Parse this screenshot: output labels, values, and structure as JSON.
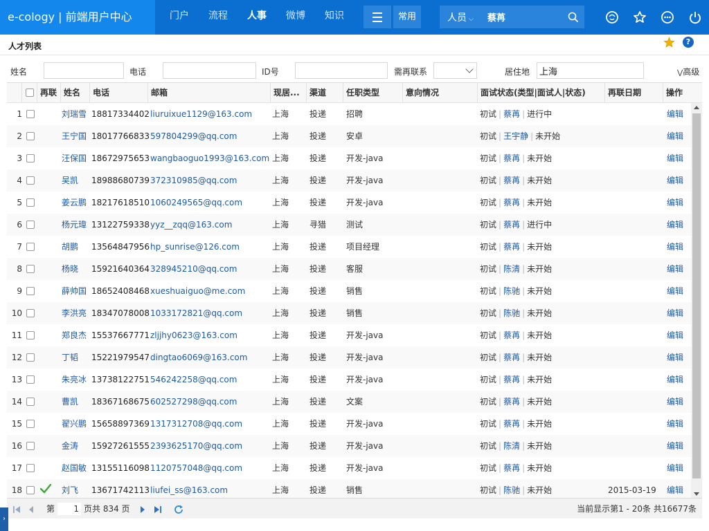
{
  "app": {
    "brand": "e-cology | 前端用户中心"
  },
  "nav": {
    "items": [
      "门户",
      "流程",
      "人事",
      "微博",
      "知识"
    ],
    "active_index": 2
  },
  "toolbar": {
    "common_label": "常用"
  },
  "search": {
    "category": "人员",
    "value": "蔡苒"
  },
  "page": {
    "title": "人才列表"
  },
  "filters": {
    "name_label": "姓名",
    "name_value": "",
    "phone_label": "电话",
    "phone_value": "",
    "id_label": "ID号",
    "id_value": "",
    "recontact_label": "需再联系",
    "recontact_value": "",
    "residence_label": "居住地",
    "residence_value": "上海",
    "advanced_label": "高级"
  },
  "table": {
    "headers": {
      "recontact": "再联",
      "name": "姓名",
      "phone": "电话",
      "email": "邮箱",
      "residence": "现居...",
      "channel": "渠道",
      "position": "任职类型",
      "intention": "意向情况",
      "interview": "面试状态(类型|面试人|状态)",
      "recontact_date": "再联日期",
      "action": "操作"
    },
    "rows": [
      {
        "no": "1",
        "recontact": false,
        "name": "刘瑞雪",
        "phone": "18817334402",
        "email": "liuruixue1129@163.com",
        "residence": "上海",
        "channel": "投递",
        "position": "招聘",
        "intention": "",
        "type": "初试",
        "interviewer": "蔡苒",
        "status": "进行中",
        "date": "",
        "action": "编辑"
      },
      {
        "no": "2",
        "recontact": false,
        "name": "王宁国",
        "phone": "18017766833",
        "email": "597804299@qq.com",
        "residence": "上海",
        "channel": "投递",
        "position": "安卓",
        "intention": "",
        "type": "初试",
        "interviewer": "王宇静",
        "status": "未开始",
        "date": "",
        "action": "编辑"
      },
      {
        "no": "3",
        "recontact": false,
        "name": "汪保国",
        "phone": "18672975653",
        "email": "wangbaoguo1993@163.com",
        "residence": "上海",
        "channel": "投递",
        "position": "开发-java",
        "intention": "",
        "type": "初试",
        "interviewer": "蔡苒",
        "status": "未开始",
        "date": "",
        "action": "编辑"
      },
      {
        "no": "4",
        "recontact": false,
        "name": "吴凯",
        "phone": "18988680739",
        "email": "372310985@qq.com",
        "residence": "上海",
        "channel": "投递",
        "position": "开发-java",
        "intention": "",
        "type": "初试",
        "interviewer": "蔡苒",
        "status": "未开始",
        "date": "",
        "action": "编辑"
      },
      {
        "no": "5",
        "recontact": false,
        "name": "姜云鹏",
        "phone": "18217618510",
        "email": "1060249565@qq.com",
        "residence": "上海",
        "channel": "投递",
        "position": "开发-java",
        "intention": "",
        "type": "初试",
        "interviewer": "蔡苒",
        "status": "未开始",
        "date": "",
        "action": "编辑"
      },
      {
        "no": "6",
        "recontact": false,
        "name": "杨元瑋",
        "phone": "13122759338",
        "email": "yyz__zqq@163.com",
        "residence": "上海",
        "channel": "寻猎",
        "position": "测试",
        "intention": "",
        "type": "初试",
        "interviewer": "蔡苒",
        "status": "进行中",
        "date": "",
        "action": "编辑"
      },
      {
        "no": "7",
        "recontact": false,
        "name": "胡鹏",
        "phone": "13564847956",
        "email": "hp_sunrise@126.com",
        "residence": "上海",
        "channel": "投递",
        "position": "项目经理",
        "intention": "",
        "type": "初试",
        "interviewer": "蔡苒",
        "status": "未开始",
        "date": "",
        "action": "编辑"
      },
      {
        "no": "8",
        "recontact": false,
        "name": "杨晓",
        "phone": "15921640364",
        "email": "328945210@qq.com",
        "residence": "上海",
        "channel": "投递",
        "position": "客服",
        "intention": "",
        "type": "初试",
        "interviewer": "陈清",
        "status": "未开始",
        "date": "",
        "action": "编辑"
      },
      {
        "no": "9",
        "recontact": false,
        "name": "薛帅国",
        "phone": "18652408468",
        "email": "xueshuaiguo@me.com",
        "residence": "上海",
        "channel": "投递",
        "position": "销售",
        "intention": "",
        "type": "初试",
        "interviewer": "陈驰",
        "status": "未开始",
        "date": "",
        "action": "编辑"
      },
      {
        "no": "10",
        "recontact": false,
        "name": "李洪亮",
        "phone": "18347078008",
        "email": "1033172821@qq.com",
        "residence": "上海",
        "channel": "投递",
        "position": "销售",
        "intention": "",
        "type": "初试",
        "interviewer": "陈驰",
        "status": "未开始",
        "date": "",
        "action": "编辑"
      },
      {
        "no": "11",
        "recontact": false,
        "name": "郑良杰",
        "phone": "15537667771",
        "email": "zljjhy0623@163.com",
        "residence": "上海",
        "channel": "投递",
        "position": "开发-java",
        "intention": "",
        "type": "初试",
        "interviewer": "蔡苒",
        "status": "未开始",
        "date": "",
        "action": "编辑"
      },
      {
        "no": "12",
        "recontact": false,
        "name": "丁韬",
        "phone": "15221979547",
        "email": "dingtao6069@163.com",
        "residence": "上海",
        "channel": "投递",
        "position": "开发-java",
        "intention": "",
        "type": "初试",
        "interviewer": "蔡苒",
        "status": "未开始",
        "date": "",
        "action": "编辑"
      },
      {
        "no": "13",
        "recontact": false,
        "name": "朱亮冰",
        "phone": "13738122751",
        "email": "546242258@qq.com",
        "residence": "上海",
        "channel": "投递",
        "position": "开发-java",
        "intention": "",
        "type": "初试",
        "interviewer": "蔡苒",
        "status": "未开始",
        "date": "",
        "action": "编辑"
      },
      {
        "no": "14",
        "recontact": false,
        "name": "曹凯",
        "phone": "18367168675",
        "email": "602527298@qq.com",
        "residence": "上海",
        "channel": "投递",
        "position": "文案",
        "intention": "",
        "type": "初试",
        "interviewer": "蔡苒",
        "status": "未开始",
        "date": "",
        "action": "编辑"
      },
      {
        "no": "15",
        "recontact": false,
        "name": "翟兴鹏",
        "phone": "15658897369",
        "email": "1317312708@qq.com",
        "residence": "上海",
        "channel": "投递",
        "position": "开发-java",
        "intention": "",
        "type": "初试",
        "interviewer": "蔡苒",
        "status": "未开始",
        "date": "",
        "action": "编辑"
      },
      {
        "no": "16",
        "recontact": false,
        "name": "金涛",
        "phone": "15927261555",
        "email": "2393625170@qq.com",
        "residence": "上海",
        "channel": "投递",
        "position": "开发-java",
        "intention": "",
        "type": "初试",
        "interviewer": "陈清",
        "status": "未开始",
        "date": "",
        "action": "编辑"
      },
      {
        "no": "17",
        "recontact": false,
        "name": "赵国敏",
        "phone": "13155116098",
        "email": "1120757048@qq.com",
        "residence": "上海",
        "channel": "投递",
        "position": "开发-java",
        "intention": "",
        "type": "初试",
        "interviewer": "蔡苒",
        "status": "未开始",
        "date": "",
        "action": "编辑"
      },
      {
        "no": "18",
        "recontact": true,
        "name": "刘飞",
        "phone": "13671742113",
        "email": "liufei_ss@163.com",
        "residence": "上海",
        "channel": "投递",
        "position": "销售",
        "intention": "",
        "type": "初试",
        "interviewer": "陈驰",
        "status": "未开始",
        "date": "2015-03-19",
        "action": "编辑"
      }
    ]
  },
  "pager": {
    "page_prefix": "第",
    "current_page": "1",
    "total_pages_text": "页共 834 页",
    "summary": "当前显示第1 - 20条 共16677条"
  },
  "colors": {
    "topbar": "#0a6fd1",
    "brand": "#1387ec",
    "link": "#1f5aa3",
    "star": "#f0b400"
  },
  "icons": {
    "top": [
      "compass-icon",
      "star-icon",
      "more-icon",
      "power-icon"
    ],
    "pager": [
      "first-page-icon",
      "prev-page-icon",
      "next-page-icon",
      "last-page-icon",
      "refresh-icon"
    ]
  }
}
